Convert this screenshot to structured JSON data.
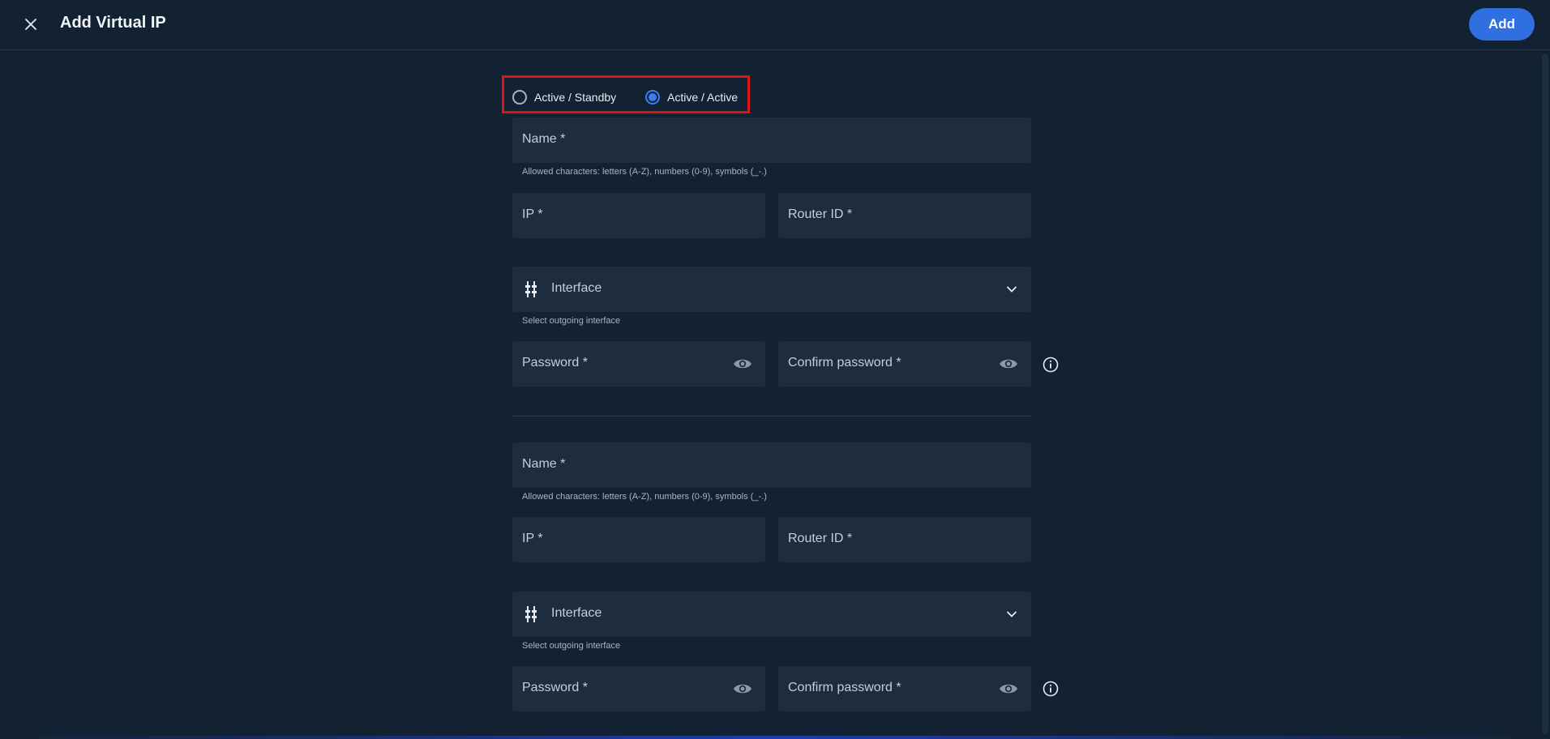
{
  "header": {
    "title": "Add Virtual IP",
    "add_label": "Add"
  },
  "mode": {
    "options": [
      "Active / Standby",
      "Active / Active"
    ],
    "selected": "Active / Active"
  },
  "groups": [
    {
      "name_label": "Name *",
      "name_hint": "Allowed characters: letters (A-Z), numbers (0-9), symbols (_-.)",
      "ip_label": "IP *",
      "router_label": "Router ID *",
      "interface_label": "Interface",
      "interface_hint": "Select outgoing interface",
      "password_label": "Password *",
      "confirm_label": "Confirm password *"
    },
    {
      "name_label": "Name *",
      "name_hint": "Allowed characters: letters (A-Z), numbers (0-9), symbols (_-.)",
      "ip_label": "IP *",
      "router_label": "Router ID *",
      "interface_label": "Interface",
      "interface_hint": "Select outgoing interface",
      "password_label": "Password *",
      "confirm_label": "Confirm password *"
    }
  ],
  "icons": {
    "close": "close-icon",
    "eye": "eye-icon",
    "chevron": "chevron-down-icon",
    "interface": "ethernet-port-icon",
    "info": "info-icon"
  },
  "colors": {
    "background": "#132232",
    "field": "#1d2d3d",
    "accent": "#2f6fe0",
    "highlight": "#e01313"
  }
}
